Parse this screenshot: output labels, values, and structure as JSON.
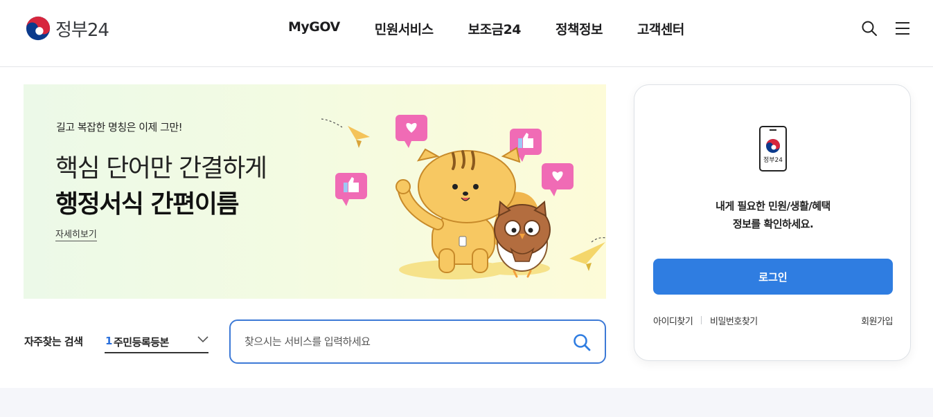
{
  "header": {
    "logo_text": "정부24",
    "nav": [
      "MyGOV",
      "민원서비스",
      "보조금24",
      "정책정보",
      "고객센터"
    ],
    "icons": [
      "search-icon",
      "menu-icon"
    ]
  },
  "banner": {
    "subtitle": "길고 복잡한 명칭은 이제 그만!",
    "title_line1": "핵심 단어만 간결하게",
    "title_line2": "행정서식 간편이름",
    "more_link": "자세히보기"
  },
  "search": {
    "frequent_label": "자주찾는 검색",
    "frequent_rank": "1",
    "frequent_item": "주민등록등본",
    "placeholder": "찾으시는 서비스를 입력하세요"
  },
  "login": {
    "app_label": "정부24",
    "message_line1": "내게 필요한 민원/생활/혜택",
    "message_line2": "정보를 확인하세요.",
    "login_button": "로그인",
    "find_id": "아이디찾기",
    "find_password": "비밀번호찾기",
    "join": "회원가입"
  },
  "colors": {
    "accent_blue": "#2f7de1",
    "search_border": "#3c79d6",
    "heart_pink": "#f06bb5",
    "character_yellow": "#f7c862"
  }
}
